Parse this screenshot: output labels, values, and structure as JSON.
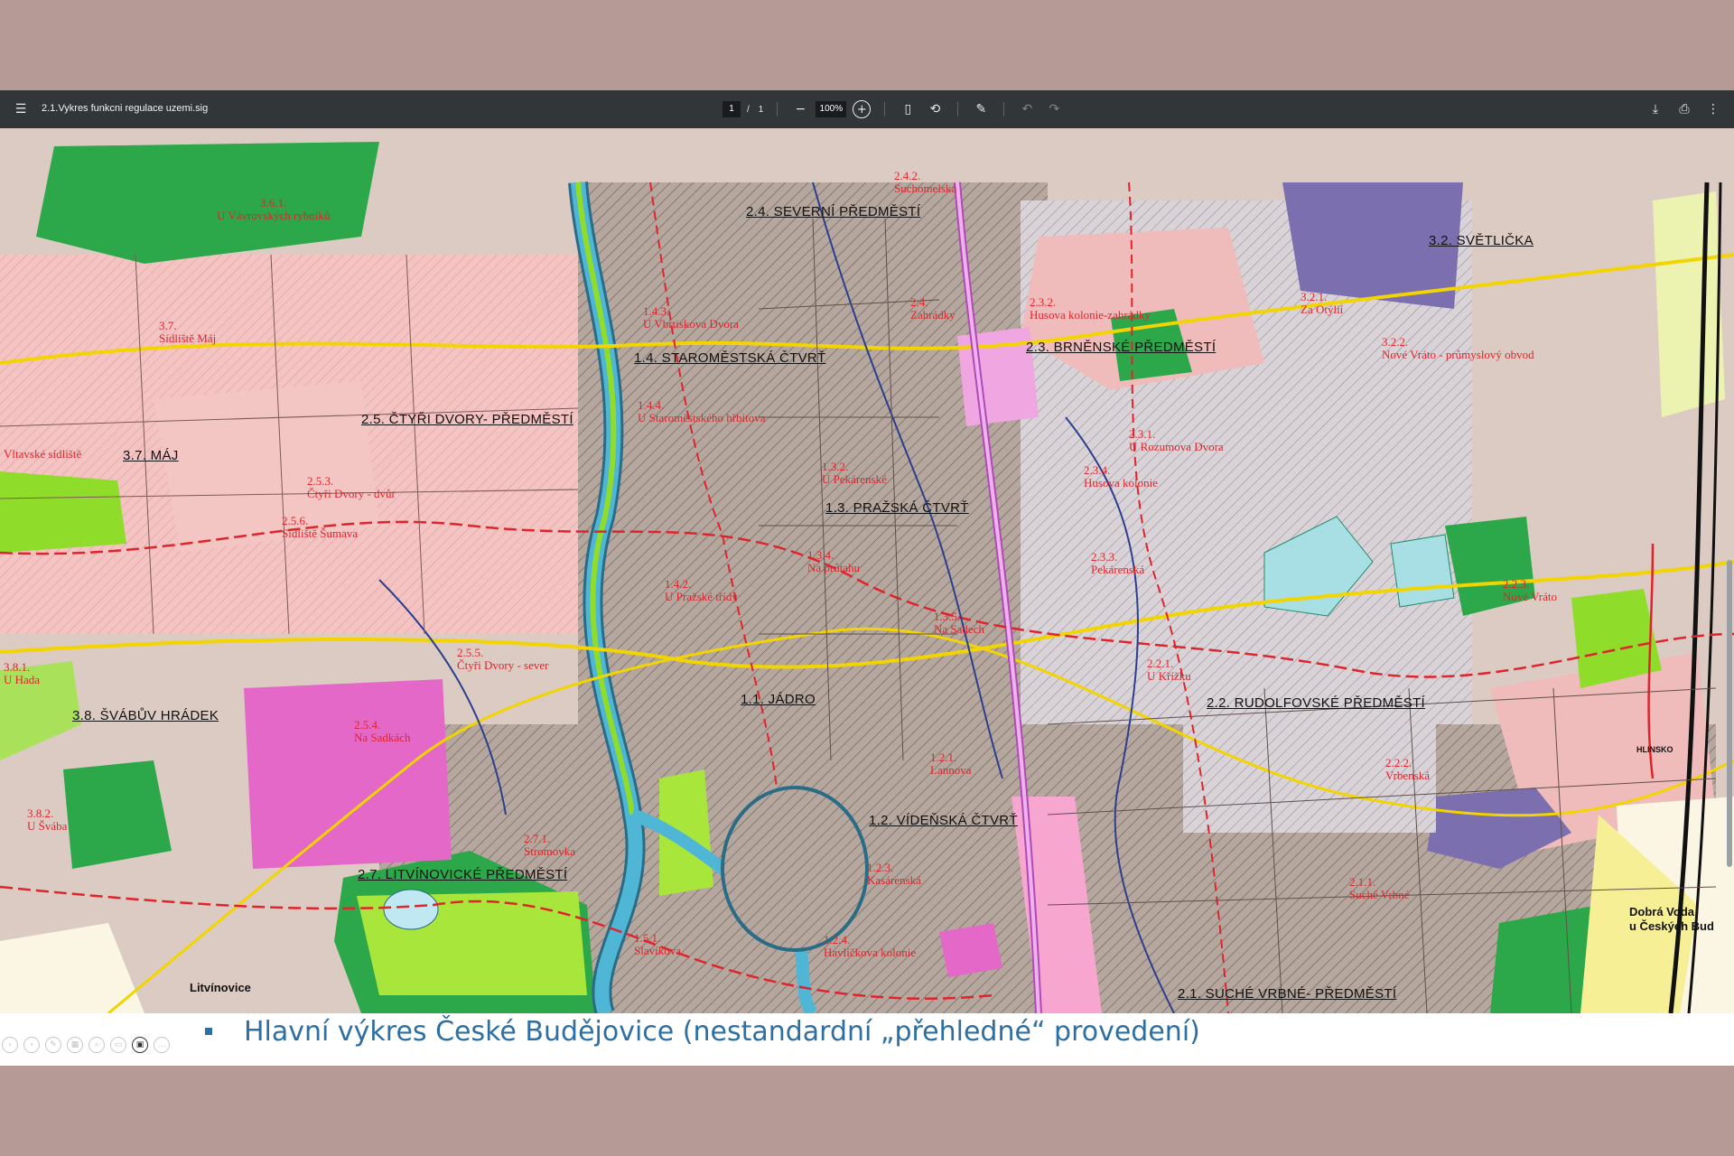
{
  "viewer": {
    "title": "2.1.Vykres funkcni regulace uzemi.sig",
    "page_current": "1",
    "page_sep": "/",
    "page_total": "1",
    "zoom_out": "−",
    "zoom": "100%",
    "zoom_in": "+"
  },
  "icons": {
    "menu": "☰",
    "fit": "▯",
    "rotate": "⟲",
    "annotate": "✎",
    "undo": "↶",
    "redo": "↷",
    "download": "⤓",
    "print": "⎙",
    "more": "⋮"
  },
  "map_labels": {
    "severni": "2.4. SEVERNÍ PŘEDMĚSTÍ",
    "svetlicka": "3.2. SVĚTLIČKA",
    "staromestska": "1.4. STAROMĚSTSKÁ ČTVRŤ",
    "brnenske": "2.3. BRNĚNSKÉ PŘEDMĚSTÍ",
    "ctyri_dvory": "2.5. ČTYŘI DVORY- PŘEDMĚSTÍ",
    "maj": "3.7. MÁJ",
    "prazska": "1.3. PRAŽSKÁ ČTVRŤ",
    "svabuv": "3.8. ŠVÁBŮV HRÁDEK",
    "jadro": "1.1. JÁDRO",
    "rudolfovske": "2.2. RUDOLFOVSKÉ PŘEDMĚSTÍ",
    "videnska": "1.2. VÍDEŇSKÁ ČTVRŤ",
    "litvinovicke": "2.7. LITVÍNOVICKÉ PŘEDMĚSTÍ",
    "suche_vrbne": "2.1. SUCHÉ VRBNÉ- PŘEDMĚSTÍ"
  },
  "zone_labels": {
    "z361": "3.6.1.\nU Vávrovských rybníků",
    "z321": "3.2.1.\nZa Otýlií",
    "z322": "3.2.2.\nNové Vráto - průmyslový obvod",
    "z431": "1.4.3.\nU Vbrtiskova Dvora",
    "z441": "1.4.4.\nU Staroměstského hřbitova",
    "z422": "2.4.2.\nSuchomelská",
    "z24z": "2.4.\nZahrádky",
    "z232": "2.3.2.\nHusova kolonie-zahrádky",
    "z231": "2.3.1.\nU Rozumova Dvora",
    "z234": "2.3.4.\nHusova kolonie",
    "z233": "2.3.3.\nPekárenská",
    "z223": "2.2.3.\nNové Vráto",
    "z221": "2.2.1.\nU Křížku",
    "z222": "2.2.2.\nVrbenská",
    "z211": "2.1.1.\nSuché Vrbné",
    "z253": "2.5.3.\nČtyři Dvory - dvůr",
    "z256": "2.5.6.\nSídliště Šumava",
    "z255": "2.5.5.\nČtyři Dvory - sever",
    "z254": "2.5.4.\nNa Sadkách",
    "z381": "3.8.1.\nU Hada",
    "z382": "3.8.2.\nU Švába",
    "z271": "2.7.1.\nStromovka",
    "z132": "1.3.2.\nU Pekárenské",
    "z134": "1.3.4.\nNa průtahu",
    "z142": "1.4.2.\nU Pražské třídy",
    "z135": "1.3.5.\nNa Sadech",
    "z121": "1.2.1.\nLannova",
    "z123": "1.2.3.\nKasárenská",
    "z124": "1.2.4.\nHavlíčkova kolonie",
    "z151": "1.5.1.\nSlavíkova",
    "z37h": "3.7.\nSídliště Máj",
    "z37s": "Vltavské sídliště"
  },
  "place_labels": {
    "dobra_voda": "Dobrá Voda\nu Českých Bud",
    "litvinovice": "Litvínovice",
    "hlinsko": "HLINSKO"
  },
  "caption": {
    "text": "Hlavní výkres České Budějovice (nestandardní „přehledné“ provedení)"
  },
  "colors": {
    "accent": "#2d6fa3",
    "zone_red": "#e0242b",
    "green": "#4caf50",
    "bright_green": "#8fdc2a",
    "pink": "#e368c8",
    "purple": "#7b6fb0",
    "river": "#4fb6d6"
  }
}
